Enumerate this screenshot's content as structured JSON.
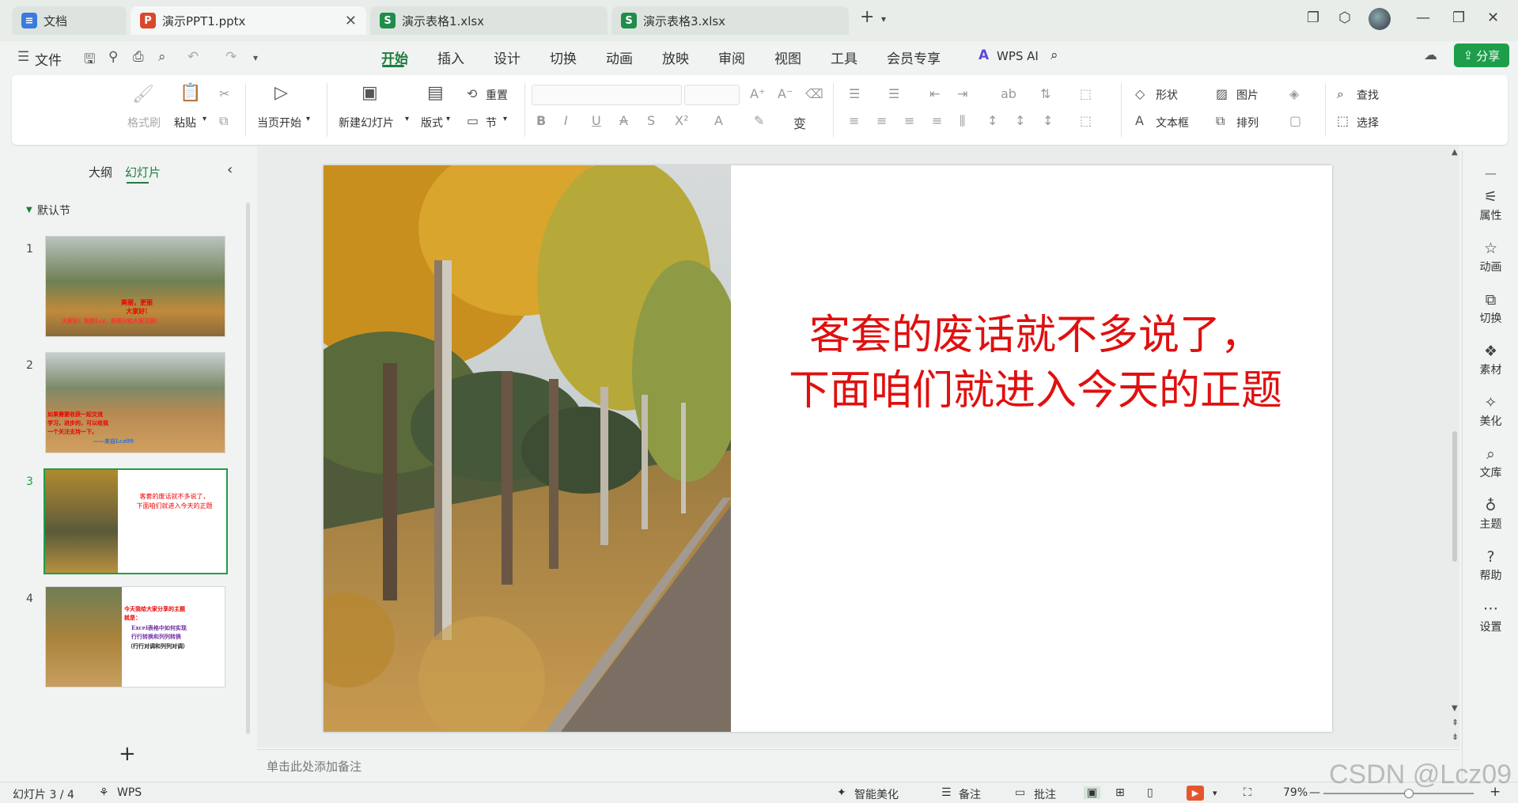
{
  "tabs": [
    {
      "label": "文档",
      "icon": "doc-icon"
    },
    {
      "label": "演示PPT1.pptx",
      "icon_letter": "P"
    },
    {
      "label": "演示表格1.xlsx",
      "icon_letter": "S"
    },
    {
      "label": "演示表格3.xlsx",
      "icon_letter": "S"
    }
  ],
  "menu": {
    "file": "文件",
    "items": [
      "开始",
      "插入",
      "设计",
      "切换",
      "动画",
      "放映",
      "审阅",
      "视图",
      "工具",
      "会员专享"
    ],
    "wps_ai": "WPS AI",
    "share": "分享"
  },
  "ribbon": {
    "format_painter": "格式刷",
    "paste": "粘贴",
    "from_current": "当页开始",
    "new_slide": "新建幻灯片",
    "layout": "版式",
    "reset": "重置",
    "section": "节",
    "shape": "形状",
    "picture": "图片",
    "find": "查找",
    "textbox": "文本框",
    "arrange": "排列",
    "select": "选择"
  },
  "left_pane": {
    "outline_tab": "大纲",
    "slides_tab": "幻灯片",
    "section_name": "默认节",
    "thumbs": [
      {
        "num": "1",
        "lines": [
          "美丽，更丽",
          "大家好!",
          "大家好！我是Lcz，很高兴和大家见面！"
        ]
      },
      {
        "num": "2",
        "lines": [
          "如果需要收获一起交流",
          "学习，进步的，可以给我",
          "一个关注支持一下。",
          "——来自Lcz09"
        ]
      },
      {
        "num": "3",
        "lines": [
          "客套的废话就不多说了，",
          "下面咱们就进入今天的正题"
        ]
      },
      {
        "num": "4",
        "lines": [
          "今天我给大家分享的主题",
          "就是：",
          "Excel表格中如何实现",
          "行行转换和列列转换",
          "（行行对调和列列对调）"
        ]
      }
    ],
    "add_slide": "+"
  },
  "slide": {
    "line1": "客套的废话就不多说了，",
    "line2": "下面咱们就进入今天的正题"
  },
  "notes_placeholder": "单击此处添加备注",
  "right_sidebar": [
    "属性",
    "动画",
    "切换",
    "素材",
    "美化",
    "文库",
    "主题",
    "帮助",
    "设置"
  ],
  "status": {
    "slide_counter": "幻灯片 3 / 4",
    "wps": "WPS",
    "smart_beautify": "智能美化",
    "notes": "备注",
    "comments": "批注",
    "zoom": "79%",
    "zoom_level": 0.57
  },
  "watermark": "CSDN @Lcz09",
  "colors": {
    "accent": "#1e9e4a",
    "slide_text": "#e01010",
    "ppt_icon": "#d9482b",
    "xls_icon": "#1e8e4a",
    "doc_icon": "#3a7be0"
  }
}
